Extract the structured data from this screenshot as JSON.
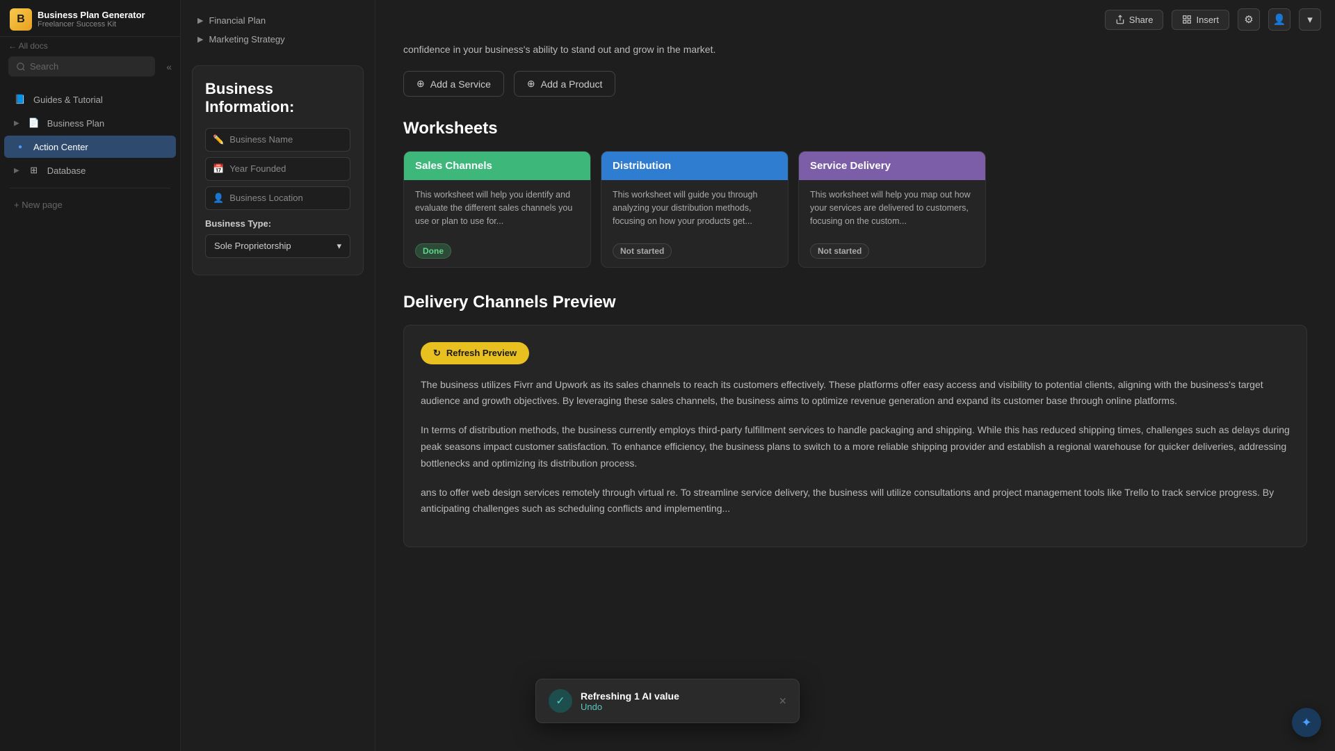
{
  "app": {
    "all_docs_label": "All docs"
  },
  "sidebar": {
    "logo_text": "B",
    "title": "Business Plan Generator",
    "subtitle": "Freelancer Success Kit",
    "search_placeholder": "Search",
    "collapse_icon": "«",
    "nav_items": [
      {
        "id": "guides",
        "label": "Guides & Tutorial",
        "icon": "📘",
        "active": false
      },
      {
        "id": "business-plan",
        "label": "Business Plan",
        "icon": "📄",
        "active": false,
        "expandable": true
      },
      {
        "id": "action-center",
        "label": "Action Center",
        "icon": "🔵",
        "active": true
      },
      {
        "id": "database",
        "label": "Database",
        "icon": "⊞",
        "active": false,
        "expandable": true
      }
    ],
    "new_page_label": "+ New page"
  },
  "outline": {
    "items": [
      {
        "label": "Financial Plan"
      },
      {
        "label": "Marketing Strategy"
      }
    ]
  },
  "business_info": {
    "card_title": "Business Information:",
    "fields": [
      {
        "icon": "✏️",
        "label": "Business Name"
      },
      {
        "icon": "📅",
        "label": "Year Founded"
      },
      {
        "icon": "👤",
        "label": "Business Location"
      }
    ],
    "type_label": "Business Type:",
    "type_value": "Sole Proprietorship",
    "type_dropdown_icon": "▾"
  },
  "header": {
    "share_label": "Share",
    "insert_label": "Insert",
    "share_icon": "↑",
    "insert_icon": "⊞",
    "settings_icon": "⚙",
    "user_icon": "👤",
    "chevron_icon": "▾"
  },
  "services_section": {
    "description": "confidence in your business's ability to stand out and grow in the market.",
    "add_service_label": "Add a Service",
    "add_product_label": "Add a Product",
    "plus_icon": "+"
  },
  "worksheets": {
    "section_title": "Worksheets",
    "cards": [
      {
        "id": "sales-channels",
        "header": "Sales Channels",
        "header_class": "green",
        "body": "This worksheet will help you identify and evaluate the different sales channels you use or plan to use for...",
        "status": "Done",
        "status_class": "status-done"
      },
      {
        "id": "distribution",
        "header": "Distribution",
        "header_class": "blue",
        "body": "This worksheet will guide you through analyzing your distribution methods, focusing on how your products get...",
        "status": "Not started",
        "status_class": "status-not-started"
      },
      {
        "id": "service-delivery",
        "header": "Service Delivery",
        "header_class": "purple",
        "body": "This worksheet will help you map out how your services are delivered to customers, focusing on the custom...",
        "status": "Not started",
        "status_class": "status-not-started"
      }
    ]
  },
  "delivery_channels": {
    "section_title": "Delivery Channels Preview",
    "refresh_label": "Refresh Preview",
    "refresh_icon": "↻",
    "paragraph_1": "The business utilizes Fivrr and Upwork as its sales channels to reach its customers effectively. These platforms offer easy access and visibility to potential clients, aligning with the business's target audience and growth objectives. By leveraging these sales channels, the business aims to optimize revenue generation and expand its customer base through online platforms.",
    "paragraph_2": "In terms of distribution methods, the business currently employs third-party fulfillment services to handle packaging and shipping. While this has reduced shipping times, challenges such as delays during peak seasons impact customer satisfaction. To enhance efficiency, the business plans to switch to a more reliable shipping provider and establish a regional warehouse for quicker deliveries, addressing bottlenecks and optimizing its distribution process.",
    "paragraph_3": "ans to offer web design services remotely through virtual re. To streamline service delivery, the business will utilize consultations and project management tools like Trello to track service progress. By anticipating challenges such as scheduling conflicts and implementing..."
  },
  "toast": {
    "check_icon": "✓",
    "title": "Refreshing 1 AI value",
    "action_label": "Undo",
    "close_icon": "×"
  },
  "floating_help": {
    "icon": "✦"
  }
}
